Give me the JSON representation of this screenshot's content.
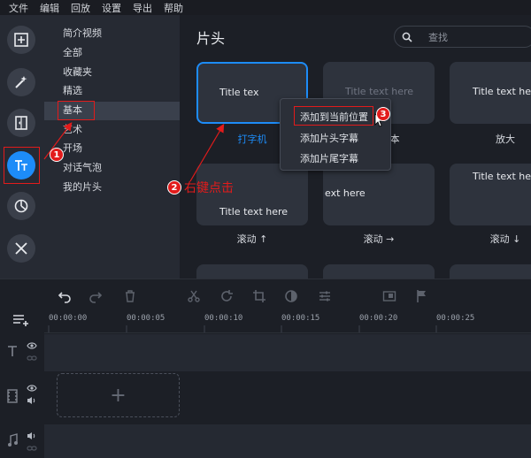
{
  "menubar": {
    "items": [
      "文件",
      "编辑",
      "回放",
      "设置",
      "导出",
      "帮助"
    ]
  },
  "toolbar": {
    "tools": [
      {
        "name": "import-tool",
        "icon": "add-media-icon"
      },
      {
        "name": "filters-tool",
        "icon": "magic-wand-icon"
      },
      {
        "name": "transitions-tool",
        "icon": "transition-icon"
      },
      {
        "name": "titles-tool",
        "icon": "titles-icon",
        "active": true
      },
      {
        "name": "stickers-tool",
        "icon": "sticker-icon"
      },
      {
        "name": "more-tools",
        "icon": "tools-icon"
      }
    ]
  },
  "categories": {
    "items": [
      "简介视频",
      "全部",
      "收藏夹",
      "精选",
      "基本",
      "艺术",
      "开场",
      "对话气泡",
      "我的片头"
    ],
    "selected": "基本"
  },
  "content": {
    "title": "片头",
    "search_placeholder": "查找",
    "thumbnails": [
      {
        "text": "Title tex",
        "caption": "打字机"
      },
      {
        "text": "Title text here",
        "caption": "本"
      },
      {
        "text": "Title text here",
        "caption": "放大"
      },
      {
        "text": "Title text here",
        "caption": "滚动 ↑"
      },
      {
        "text": "ext here",
        "caption": "滚动 →"
      },
      {
        "text": "Title text here",
        "caption": "滚动 ↓"
      }
    ]
  },
  "context_menu": {
    "items": [
      "添加到当前位置",
      "添加片头字幕",
      "添加片尾字幕"
    ]
  },
  "annotations": {
    "n1": "1",
    "n2": "2",
    "n3": "3",
    "label2": "右键点击"
  },
  "timeline": {
    "ticks": [
      "00:00:00",
      "00:00:05",
      "00:00:10",
      "00:00:15",
      "00:00:20",
      "00:00:25"
    ],
    "add_symbol": "+"
  },
  "colors": {
    "accent": "#1d8cf8",
    "annotation": "#e21b1b"
  }
}
